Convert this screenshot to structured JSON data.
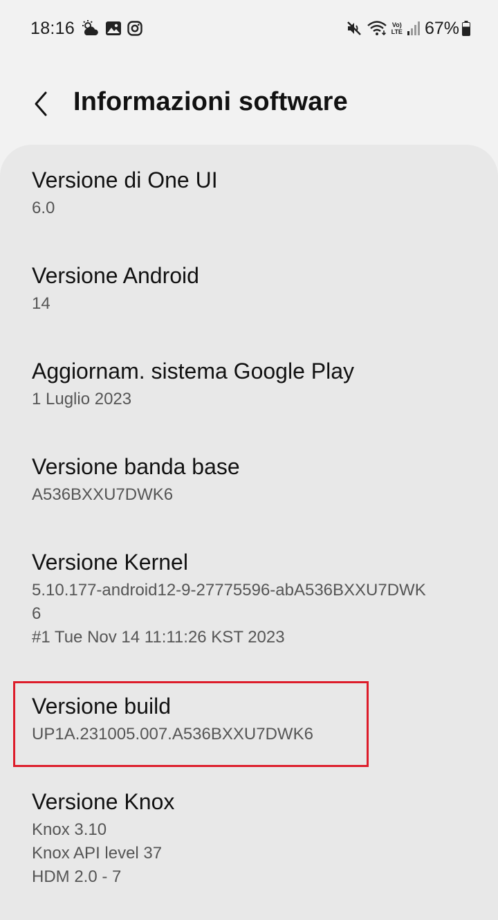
{
  "status_bar": {
    "time": "18:16",
    "left_icons": [
      "weather-icon",
      "gallery-icon",
      "instagram-icon"
    ],
    "right_icons": [
      "mute-icon",
      "wifi-icon",
      "volte-lte-icon",
      "signal-icon"
    ],
    "volte_label": "Vo)",
    "lte_label": "LTE",
    "battery_percent": "67%",
    "battery_level": 0.67
  },
  "header": {
    "title": "Informazioni software",
    "back_icon": "back-chevron-icon"
  },
  "items": [
    {
      "title": "Versione di One UI",
      "lines": [
        "6.0"
      ]
    },
    {
      "title": "Versione Android",
      "lines": [
        "14"
      ]
    },
    {
      "title": "Aggiornam. sistema Google Play",
      "lines": [
        "1 Luglio 2023"
      ]
    },
    {
      "title": "Versione banda base",
      "lines": [
        "A536BXXU7DWK6"
      ]
    },
    {
      "title": "Versione Kernel",
      "lines": [
        "5.10.177-android12-9-27775596-abA536BXXU7DWK",
        "6",
        "#1 Tue Nov 14 11:11:26 KST 2023"
      ]
    },
    {
      "title": "Versione build",
      "lines": [
        "UP1A.231005.007.A536BXXU7DWK6"
      ],
      "highlighted": true
    },
    {
      "title": "Versione Knox",
      "lines": [
        "Knox 3.10",
        "Knox API level 37",
        "HDM 2.0 - 7"
      ]
    }
  ],
  "colors": {
    "background": "#f2f2f2",
    "panel": "#e8e8e8",
    "highlight": "#dd1c2a",
    "subtext": "#555555"
  }
}
